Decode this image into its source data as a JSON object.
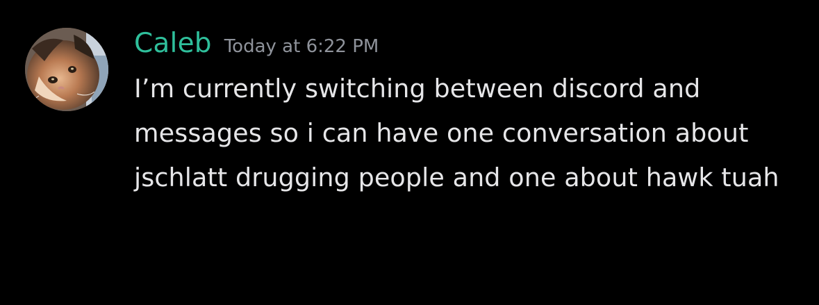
{
  "message": {
    "author": {
      "name": "Caleb",
      "name_color": "#2fbf9b",
      "avatar": "cat-avatar"
    },
    "timestamp": "Today at 6:22 PM",
    "content": "I’m currently switching between discord and messages so i can have one conversation about jschlatt drugging people and one about hawk tuah"
  },
  "colors": {
    "background": "#000000",
    "text": "#e6e6e8",
    "timestamp": "#8f939b"
  }
}
